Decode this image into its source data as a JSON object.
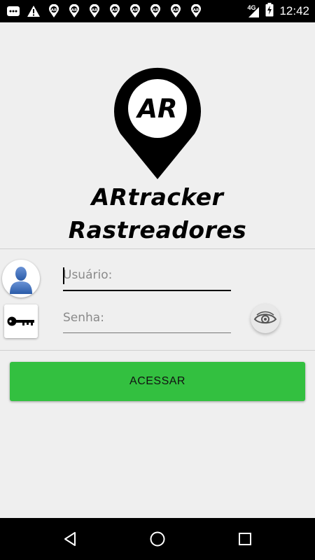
{
  "status_bar": {
    "time": "12:42",
    "network": "4G",
    "notifications": [
      "message-icon",
      "warning-icon",
      "ar-pin-icon",
      "ar-pin-icon",
      "ar-pin-icon",
      "ar-pin-icon",
      "ar-pin-icon",
      "ar-pin-icon",
      "ar-pin-icon",
      "ar-pin-icon"
    ]
  },
  "logo": {
    "mark": "AR",
    "line1": "ARtracker",
    "line2": "Rastreadores"
  },
  "login": {
    "user_placeholder": "Usuário:",
    "password_placeholder": "Senha:",
    "submit_label": "ACESSAR"
  },
  "colors": {
    "accent": "#33c040",
    "background": "#efefef",
    "bars": "#000000"
  }
}
